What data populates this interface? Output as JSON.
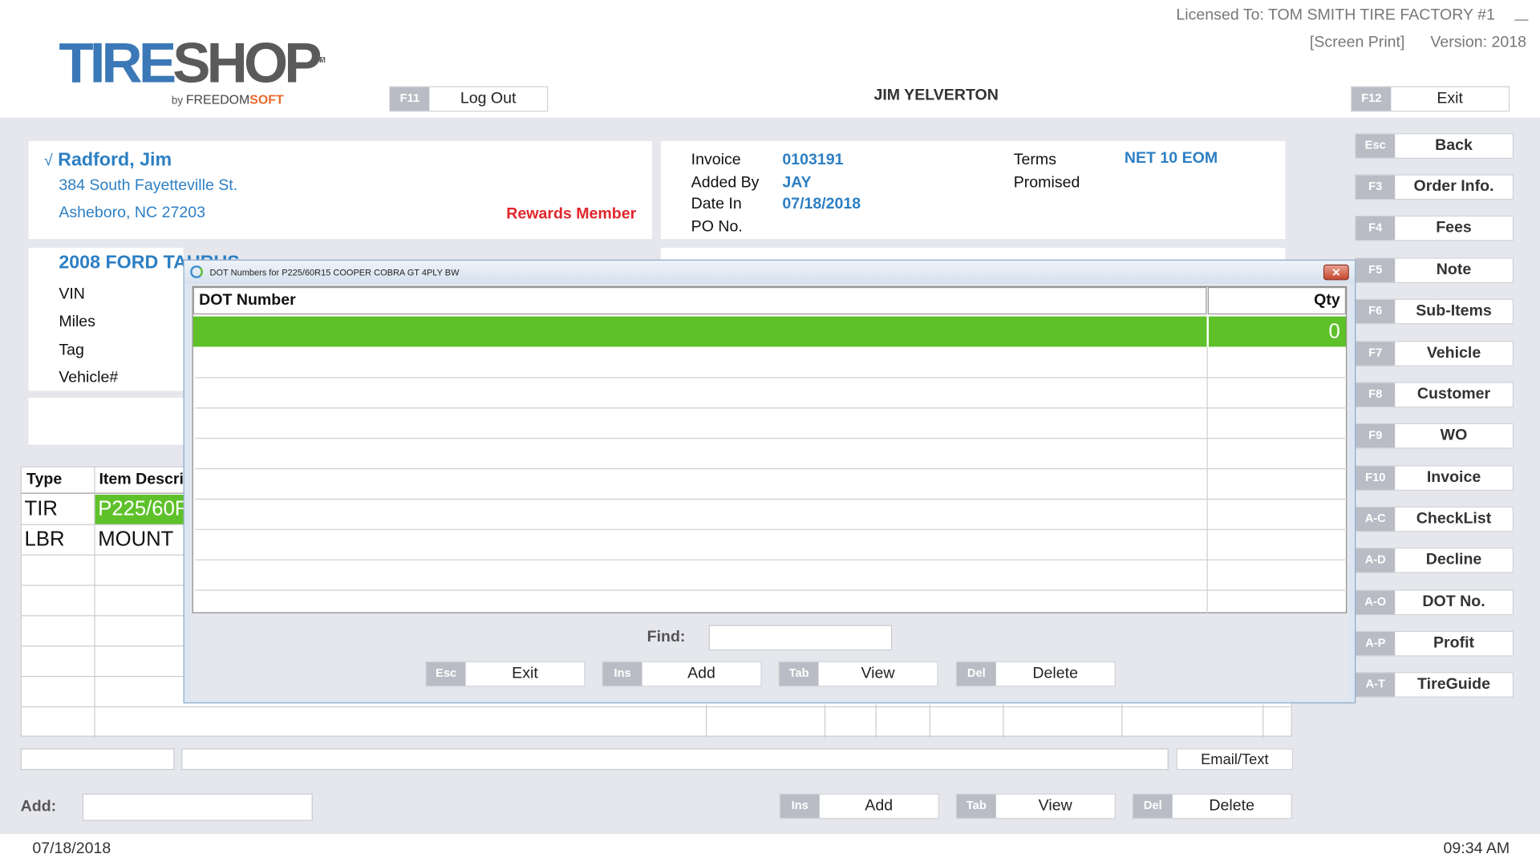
{
  "header": {
    "logo": {
      "tire": "TIRE",
      "shop": "SHOP",
      "tm": "TM",
      "by": "by",
      "freedom": "FREEDOM",
      "soft": "SOFT"
    },
    "licensed": "Licensed To: TOM SMITH TIRE FACTORY #1",
    "screen_print": "[Screen Print]",
    "version": "Version: 2018",
    "user": "JIM YELVERTON",
    "logout": {
      "key": "F11",
      "label": "Log Out"
    },
    "exit": {
      "key": "F12",
      "label": "Exit"
    }
  },
  "customer": {
    "check": "√",
    "name": "Radford, Jim",
    "address": "384 South Fayetteville St.",
    "city": "Asheboro, NC  27203",
    "rewards": "Rewards Member"
  },
  "invoice": {
    "labels": [
      "Invoice",
      "Added By",
      "Date In",
      "PO No."
    ],
    "values": [
      "0103191",
      "JAY",
      "07/18/2018",
      ""
    ],
    "terms_label": "Terms",
    "terms_value": "NET 10 EOM",
    "promised_label": "Promised"
  },
  "vehicle": {
    "title": "2008 FORD TAURUS",
    "labels": [
      "VIN",
      "Miles",
      "Tag",
      "Vehicle#"
    ]
  },
  "items": {
    "headers": [
      "Type",
      "Item Descri"
    ],
    "rows": [
      {
        "type": "TIR",
        "desc": "P225/60R"
      },
      {
        "type": "LBR",
        "desc": "MOUNT"
      }
    ]
  },
  "email_text": "Email/Text",
  "add": {
    "label": "Add:",
    "buttons": [
      {
        "key": "Ins",
        "label": "Add"
      },
      {
        "key": "Tab",
        "label": "View"
      },
      {
        "key": "Del",
        "label": "Delete"
      }
    ]
  },
  "sidebar": [
    {
      "key": "Esc",
      "label": "Back"
    },
    {
      "key": "F3",
      "label": "Order Info."
    },
    {
      "key": "F4",
      "label": "Fees"
    },
    {
      "key": "F5",
      "label": "Note"
    },
    {
      "key": "F6",
      "label": "Sub-Items"
    },
    {
      "key": "F7",
      "label": "Vehicle"
    },
    {
      "key": "F8",
      "label": "Customer"
    },
    {
      "key": "F9",
      "label": "WO"
    },
    {
      "key": "F10",
      "label": "Invoice"
    },
    {
      "key": "A-C",
      "label": "CheckList"
    },
    {
      "key": "A-D",
      "label": "Decline"
    },
    {
      "key": "A-O",
      "label": "DOT No."
    },
    {
      "key": "A-P",
      "label": "Profit"
    },
    {
      "key": "A-T",
      "label": "TireGuide"
    }
  ],
  "dialog": {
    "title": "DOT Numbers for P225/60R15 COOPER COBRA GT  4PLY BW",
    "col_dot": "DOT Number",
    "col_qty": "Qty",
    "selected_qty": "0",
    "find_label": "Find:",
    "buttons": [
      {
        "key": "Esc",
        "label": "Exit"
      },
      {
        "key": "Ins",
        "label": "Add"
      },
      {
        "key": "Tab",
        "label": "View"
      },
      {
        "key": "Del",
        "label": "Delete"
      }
    ]
  },
  "footer": {
    "date": "07/18/2018",
    "time": "09:34 AM"
  },
  "colors": {
    "accent_blue": "#2d7fc3",
    "selected_green": "#5ec12a",
    "rewards_red": "#e0262c",
    "key_grey": "#b9bcc4"
  }
}
